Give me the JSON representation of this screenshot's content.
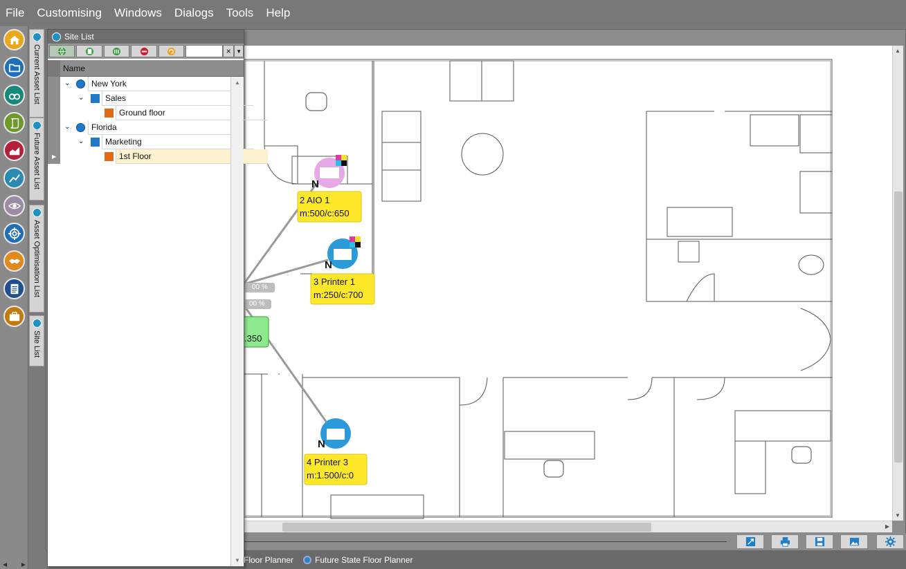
{
  "menu": [
    "File",
    "Customising",
    "Windows",
    "Dialogs",
    "Tools",
    "Help"
  ],
  "rail": {
    "modules": [
      {
        "icon": "home-icon",
        "color": "#e8a81a"
      },
      {
        "icon": "folder-icon",
        "color": "#1f6fb6"
      },
      {
        "icon": "binoculars-icon",
        "color": "#168a7a"
      },
      {
        "icon": "scroll-icon",
        "color": "#6e9a2a"
      },
      {
        "icon": "area-chart-icon",
        "color": "#b2203a"
      },
      {
        "icon": "trend-icon",
        "color": "#2a8ab0"
      },
      {
        "icon": "eye-icon",
        "color": "#9c8ba5",
        "active": true
      },
      {
        "icon": "target-icon",
        "color": "#1f6fb6"
      },
      {
        "icon": "handshake-icon",
        "color": "#e08a1c"
      },
      {
        "icon": "document-icon",
        "color": "#1f4f8e"
      },
      {
        "icon": "briefcase-icon",
        "color": "#c07a10"
      }
    ]
  },
  "vertical_tabs": [
    "Current Asset List",
    "Future Asset List",
    "Asset Optimisation List",
    "Site List"
  ],
  "site_list": {
    "title": "Site List",
    "toolbar_icons": [
      "globe-icon",
      "building-icon",
      "floors-icon",
      "remove-icon",
      "refresh-icon"
    ],
    "search_value": "",
    "clear_label": "×",
    "column_header": "Name",
    "tree": [
      {
        "label": "New York",
        "level": 0,
        "type": "site",
        "expanded": true
      },
      {
        "label": "Sales",
        "level": 1,
        "type": "building",
        "expanded": true
      },
      {
        "label": "Ground floor",
        "level": 2,
        "type": "floor"
      },
      {
        "label": "Florida",
        "level": 0,
        "type": "site",
        "expanded": true
      },
      {
        "label": "Marketing",
        "level": 1,
        "type": "building",
        "expanded": true
      },
      {
        "label": "1st Floor",
        "level": 2,
        "type": "floor",
        "selected": true
      }
    ]
  },
  "floor_plan": {
    "devices": [
      {
        "id": "aio1",
        "name": "2 AIO 1",
        "stats": "m:500/c:650",
        "badge": "N"
      },
      {
        "id": "printer1",
        "name": "3 Printer 1",
        "stats": "m:250/c:700",
        "badge": "N"
      },
      {
        "id": "printer3",
        "name": "4 Printer 3",
        "stats": "m:1.500/c:0",
        "badge": "N"
      }
    ],
    "hub_value": ".350",
    "pct_labels": [
      "00 %",
      "00 %"
    ]
  },
  "bottom_tabs": [
    "Floor Planner",
    "Future State Floor Planner"
  ],
  "bottom_toolbar_icons": [
    "expand-icon",
    "print-icon",
    "save-icon",
    "image-icon",
    "settings-icon"
  ]
}
